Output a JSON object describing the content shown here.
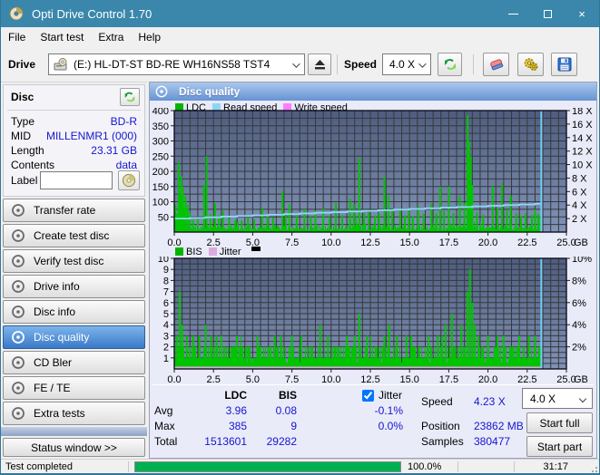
{
  "window": {
    "title": "Opti Drive Control 1.70"
  },
  "menu": {
    "items": [
      "File",
      "Start test",
      "Extra",
      "Help"
    ]
  },
  "toolbar": {
    "drive_label": "Drive",
    "drive_value": "(E:)  HL-DT-ST BD-RE  WH16NS58 TST4",
    "speed_label": "Speed",
    "speed_value": "4.0 X"
  },
  "sidebar": {
    "disc_panel": {
      "title": "Disc",
      "fields": [
        {
          "label": "Type",
          "value": "BD-R"
        },
        {
          "label": "MID",
          "value": "MILLENMR1 (000)"
        },
        {
          "label": "Length",
          "value": "23.31 GB"
        },
        {
          "label": "Contents",
          "value": "data"
        }
      ],
      "label_field": {
        "label": "Label",
        "value": ""
      }
    },
    "buttons": [
      {
        "label": "Transfer rate",
        "active": false
      },
      {
        "label": "Create test disc",
        "active": false
      },
      {
        "label": "Verify test disc",
        "active": false
      },
      {
        "label": "Drive info",
        "active": false
      },
      {
        "label": "Disc info",
        "active": false
      },
      {
        "label": "Disc quality",
        "active": true
      },
      {
        "label": "CD Bler",
        "active": false
      },
      {
        "label": "FE / TE",
        "active": false
      },
      {
        "label": "Extra tests",
        "active": false
      }
    ],
    "status_window_button": "Status window >>"
  },
  "main": {
    "header": "Disc quality",
    "stats": {
      "col_headers": [
        "LDC",
        "BIS"
      ],
      "rows": [
        {
          "label": "Avg",
          "ldc": "3.96",
          "bis": "0.08",
          "jitter": "-0.1%"
        },
        {
          "label": "Max",
          "ldc": "385",
          "bis": "9",
          "jitter": "0.0%"
        },
        {
          "label": "Total",
          "ldc": "1513601",
          "bis": "29282",
          "jitter": ""
        }
      ],
      "jitter_checkbox": "Jitter",
      "info": [
        {
          "label": "Speed",
          "value": "4.23 X"
        },
        {
          "label": "Position",
          "value": "23862 MB"
        },
        {
          "label": "Samples",
          "value": "380477"
        }
      ],
      "speed_select": "4.0 X",
      "buttons": [
        "Start full",
        "Start part"
      ]
    }
  },
  "statusbar": {
    "status": "Test completed",
    "progress_value": 100,
    "progress_pct": "100.0%",
    "time": "31:17"
  },
  "colors": {
    "titlebar": "#3a87ab",
    "value_blue": "#1515d0",
    "ldc_green": "#00c400",
    "read_speed": "#8cd6f6",
    "write_speed": "#ff7dff",
    "jitter_pink": "#dcaade",
    "plot_top": "#4e5d80",
    "plot_bottom": "#8093b8",
    "grid": "#383838",
    "end_marker": "#6ed0f8",
    "progress_green": "#00b050"
  },
  "chart_data": [
    {
      "type": "bar",
      "title": "LDC / Read speed / Write speed",
      "legend": [
        {
          "name": "LDC",
          "color": "#00b400"
        },
        {
          "name": "Read speed",
          "color": "#8cd6f6"
        },
        {
          "name": "Write speed",
          "color": "#ff7dff"
        }
      ],
      "xlim": [
        0,
        25
      ],
      "x_minor": 0.5,
      "x_ticks": [
        "0.0",
        "2.5",
        "5.0",
        "7.5",
        "10.0",
        "12.5",
        "15.0",
        "17.5",
        "20.0",
        "22.5",
        "25.0"
      ],
      "x_unit": "GB",
      "ylim_left": [
        0,
        400
      ],
      "y_minor": 25,
      "left_ticks": [
        400,
        350,
        300,
        250,
        200,
        150,
        100,
        50
      ],
      "right_ticks": [
        "18 X",
        "16 X",
        "14 X",
        "12 X",
        "10 X",
        "8 X",
        "6 X",
        "4 X",
        "2 X"
      ],
      "right_tick_values": [
        18,
        16,
        14,
        12,
        10,
        8,
        6,
        4,
        2
      ],
      "right_max": 18,
      "data_end": 23.4,
      "noise_max": 22,
      "seed": 1337,
      "bars": [
        [
          0.08,
          90
        ],
        [
          0.18,
          60
        ],
        [
          0.28,
          230
        ],
        [
          0.38,
          120
        ],
        [
          0.45,
          185
        ],
        [
          0.55,
          150
        ],
        [
          0.65,
          80
        ],
        [
          0.72,
          120
        ],
        [
          0.85,
          90
        ],
        [
          1.0,
          65
        ],
        [
          1.2,
          40
        ],
        [
          1.5,
          45
        ],
        [
          1.9,
          155
        ],
        [
          2.05,
          250
        ],
        [
          2.3,
          60
        ],
        [
          2.6,
          95
        ],
        [
          2.85,
          55
        ],
        [
          3.1,
          70
        ],
        [
          3.5,
          45
        ],
        [
          3.9,
          40
        ],
        [
          4.3,
          38
        ],
        [
          4.7,
          48
        ],
        [
          5.1,
          42
        ],
        [
          5.6,
          80
        ],
        [
          5.95,
          55
        ],
        [
          6.3,
          48
        ],
        [
          6.9,
          135
        ],
        [
          7.1,
          60
        ],
        [
          7.35,
          92
        ],
        [
          7.8,
          55
        ],
        [
          8.3,
          75
        ],
        [
          8.7,
          50
        ],
        [
          9.0,
          70
        ],
        [
          9.5,
          76
        ],
        [
          9.9,
          50
        ],
        [
          10.3,
          95
        ],
        [
          10.7,
          55
        ],
        [
          11.2,
          110
        ],
        [
          11.45,
          90
        ],
        [
          11.8,
          245
        ],
        [
          12.1,
          62
        ],
        [
          12.4,
          70
        ],
        [
          12.8,
          55
        ],
        [
          13.05,
          62
        ],
        [
          13.4,
          180
        ],
        [
          13.65,
          120
        ],
        [
          13.9,
          70
        ],
        [
          14.4,
          76
        ],
        [
          14.7,
          55
        ],
        [
          14.95,
          70
        ],
        [
          15.2,
          52
        ],
        [
          15.55,
          85
        ],
        [
          15.9,
          60
        ],
        [
          16.4,
          95
        ],
        [
          16.7,
          62
        ],
        [
          16.95,
          150
        ],
        [
          17.2,
          70
        ],
        [
          17.5,
          150
        ],
        [
          17.8,
          62
        ],
        [
          18.2,
          120
        ],
        [
          18.5,
          95
        ],
        [
          18.7,
          385
        ],
        [
          18.8,
          300
        ],
        [
          18.9,
          250
        ],
        [
          19.0,
          155
        ],
        [
          19.3,
          65
        ],
        [
          19.7,
          58
        ],
        [
          20.3,
          150
        ],
        [
          20.6,
          80
        ],
        [
          20.9,
          160
        ],
        [
          21.2,
          72
        ],
        [
          21.45,
          120
        ],
        [
          21.8,
          62
        ],
        [
          22.1,
          52
        ],
        [
          22.4,
          62
        ],
        [
          22.8,
          56
        ],
        [
          23.0,
          75
        ],
        [
          23.2,
          60
        ],
        [
          23.35,
          50
        ]
      ],
      "line_series": {
        "name": "Read speed",
        "unit": "X",
        "points": [
          [
            0,
            2.0
          ],
          [
            1,
            2.1
          ],
          [
            2,
            2.19
          ],
          [
            3,
            2.29
          ],
          [
            4,
            2.38
          ],
          [
            5,
            2.48
          ],
          [
            6,
            2.57
          ],
          [
            7,
            2.67
          ],
          [
            8,
            2.76
          ],
          [
            9,
            2.86
          ],
          [
            10,
            2.95
          ],
          [
            11,
            3.05
          ],
          [
            12,
            3.14
          ],
          [
            13,
            3.24
          ],
          [
            14,
            3.33
          ],
          [
            15,
            3.43
          ],
          [
            16,
            3.52
          ],
          [
            17,
            3.62
          ],
          [
            18,
            3.71
          ],
          [
            19,
            3.81
          ],
          [
            20,
            3.9
          ],
          [
            21,
            4.0
          ],
          [
            22,
            4.09
          ],
          [
            23,
            4.19
          ],
          [
            23.4,
            4.23
          ]
        ]
      },
      "end_marker_x": 23.4
    },
    {
      "type": "bar",
      "title": "BIS / Jitter",
      "legend": [
        {
          "name": "BIS",
          "color": "#00b400"
        },
        {
          "name": "Jitter",
          "color": "#dcaade"
        }
      ],
      "xlim": [
        0,
        25
      ],
      "x_minor": 0.5,
      "x_ticks": [
        "0.0",
        "2.5",
        "5.0",
        "7.5",
        "10.0",
        "12.5",
        "15.0",
        "17.5",
        "20.0",
        "22.5",
        "25.0"
      ],
      "x_unit": "GB",
      "ylim_left": [
        0,
        10
      ],
      "y_minor": 0.5,
      "left_ticks": [
        10,
        9,
        8,
        7,
        6,
        5,
        4,
        3,
        2,
        1
      ],
      "right_ticks": [
        "10%",
        "8%",
        "6%",
        "4%",
        "2%"
      ],
      "right_tick_values": [
        10,
        8,
        6,
        4,
        2
      ],
      "right_max": 10,
      "data_end": 23.4,
      "noise_max": 2,
      "seed": 777,
      "bars": [
        [
          0.15,
          3
        ],
        [
          0.35,
          7
        ],
        [
          0.5,
          4
        ],
        [
          0.8,
          3
        ],
        [
          1.2,
          3
        ],
        [
          1.6,
          3
        ],
        [
          2.0,
          4
        ],
        [
          2.35,
          3
        ],
        [
          2.7,
          3
        ],
        [
          3.2,
          2
        ],
        [
          4.0,
          3
        ],
        [
          4.6,
          2
        ],
        [
          5.3,
          3
        ],
        [
          6.0,
          2
        ],
        [
          6.4,
          3
        ],
        [
          6.8,
          3
        ],
        [
          7.5,
          3
        ],
        [
          8.1,
          3
        ],
        [
          8.8,
          2
        ],
        [
          9.3,
          4
        ],
        [
          9.8,
          3
        ],
        [
          10.4,
          2
        ],
        [
          11.0,
          3
        ],
        [
          11.5,
          3
        ],
        [
          11.8,
          5
        ],
        [
          12.3,
          3
        ],
        [
          12.9,
          2
        ],
        [
          13.4,
          3
        ],
        [
          13.7,
          4
        ],
        [
          14.2,
          3
        ],
        [
          14.8,
          3
        ],
        [
          15.1,
          3
        ],
        [
          15.6,
          2
        ],
        [
          16.2,
          3
        ],
        [
          16.8,
          3
        ],
        [
          17.3,
          4
        ],
        [
          17.7,
          5
        ],
        [
          18.3,
          4
        ],
        [
          18.7,
          7
        ],
        [
          18.85,
          9
        ],
        [
          19.0,
          6
        ],
        [
          19.15,
          4
        ],
        [
          19.4,
          3
        ],
        [
          20.0,
          3
        ],
        [
          20.6,
          3
        ],
        [
          21.0,
          3
        ],
        [
          21.5,
          2
        ],
        [
          22.0,
          3
        ],
        [
          22.6,
          3
        ],
        [
          23.0,
          3
        ],
        [
          23.3,
          2
        ]
      ],
      "jitter_line_y": 0.12,
      "end_marker_x": 23.4
    }
  ]
}
